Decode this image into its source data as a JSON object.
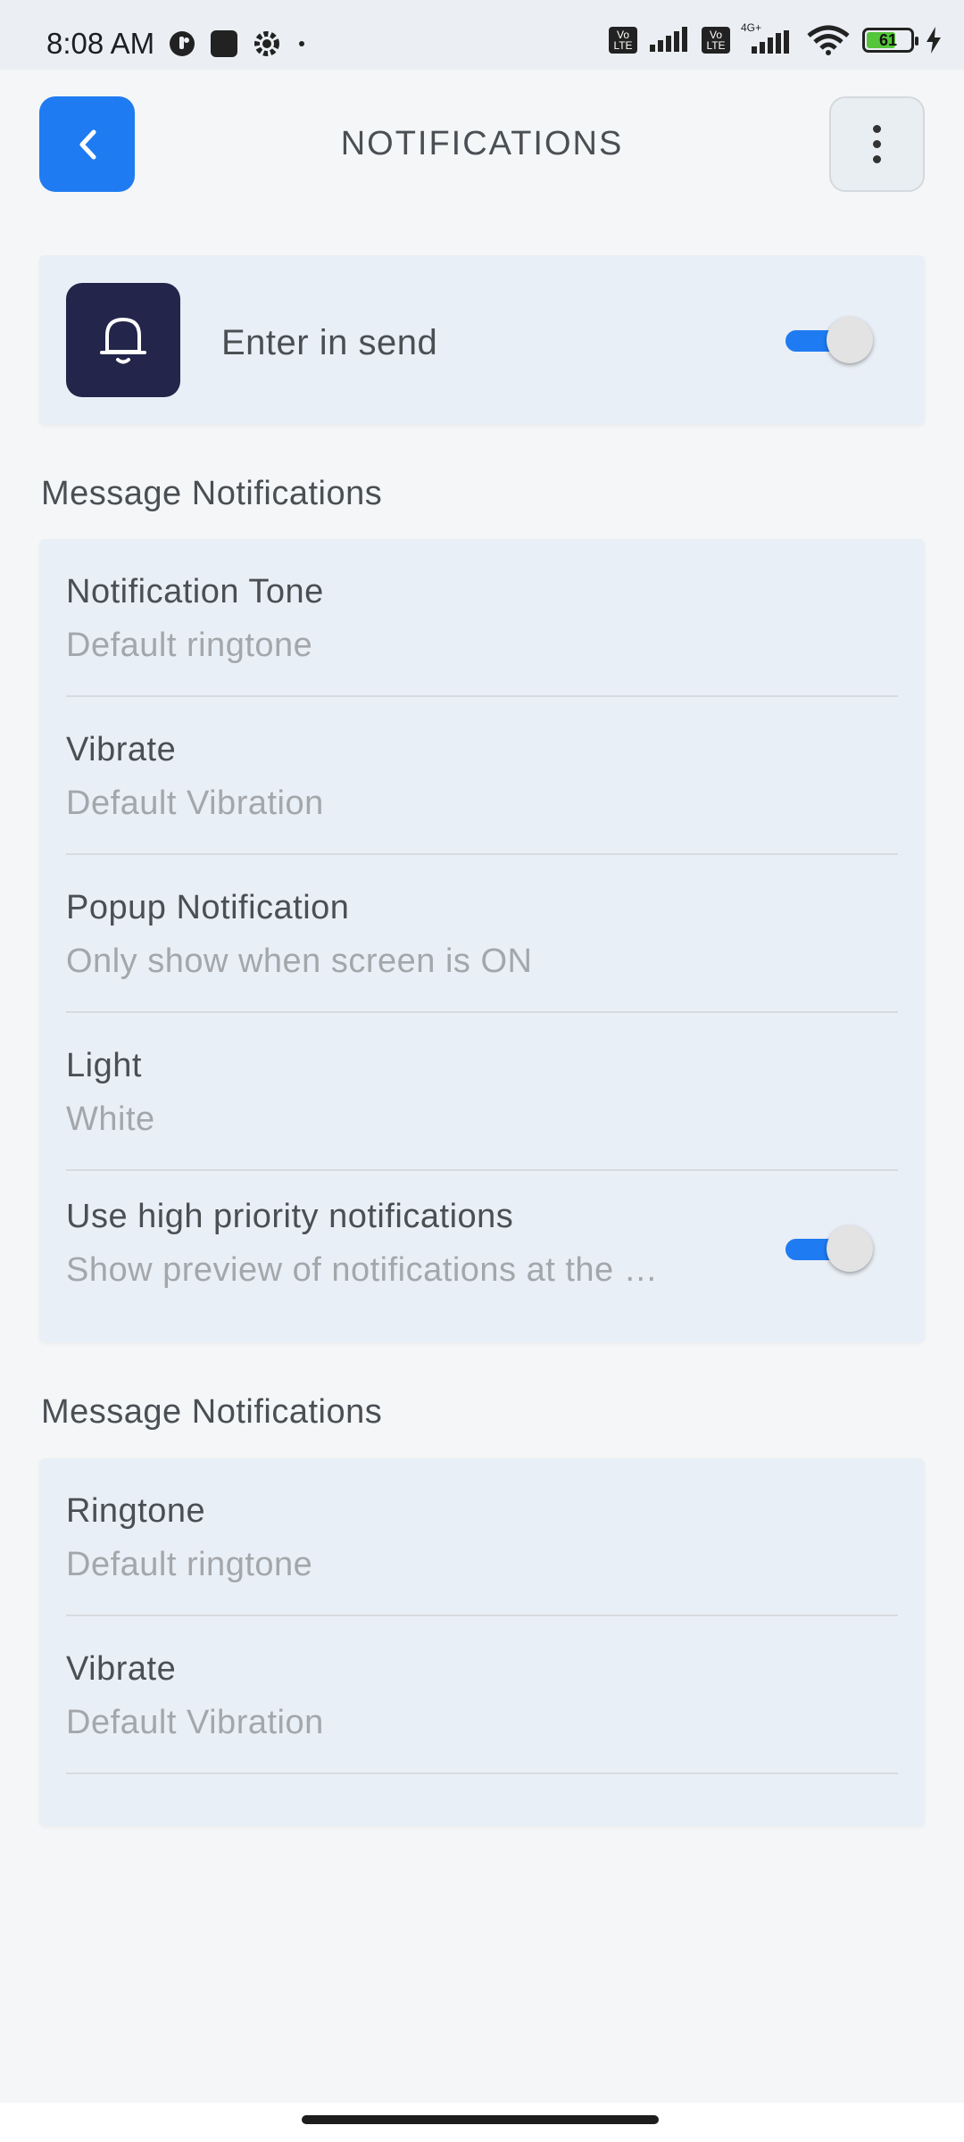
{
  "status_bar": {
    "time": "8:08 AM",
    "battery_level": "61",
    "signal_label_1": "Vo LTE",
    "signal_label_2": "Vo LTE",
    "network": "4G+"
  },
  "header": {
    "title": "NOTIFICATIONS",
    "back_icon": "chevron-left-icon",
    "menu_icon": "more-vertical-icon"
  },
  "top_card": {
    "icon": "bell-icon",
    "label": "Enter in send",
    "toggle_on": true
  },
  "section1": {
    "title": "Message Notifications",
    "items": [
      {
        "title": "Notification Tone",
        "subtitle": "Default ringtone"
      },
      {
        "title": "Vibrate",
        "subtitle": "Default Vibration"
      },
      {
        "title": "Popup Notification",
        "subtitle": "Only show when screen is ON"
      },
      {
        "title": "Light",
        "subtitle": "White"
      },
      {
        "title": "Use high priority notifications",
        "subtitle": "Show preview of notifications at the …",
        "toggle_on": true
      }
    ]
  },
  "section2": {
    "title": "Message Notifications",
    "items": [
      {
        "title": "Ringtone",
        "subtitle": "Default ringtone"
      },
      {
        "title": "Vibrate",
        "subtitle": "Default Vibration"
      }
    ]
  },
  "colors": {
    "accent": "#1f7bf1",
    "bell_bg": "#23264a",
    "card_bg": "#e9eff6",
    "page_bg": "#f5f6f7"
  }
}
